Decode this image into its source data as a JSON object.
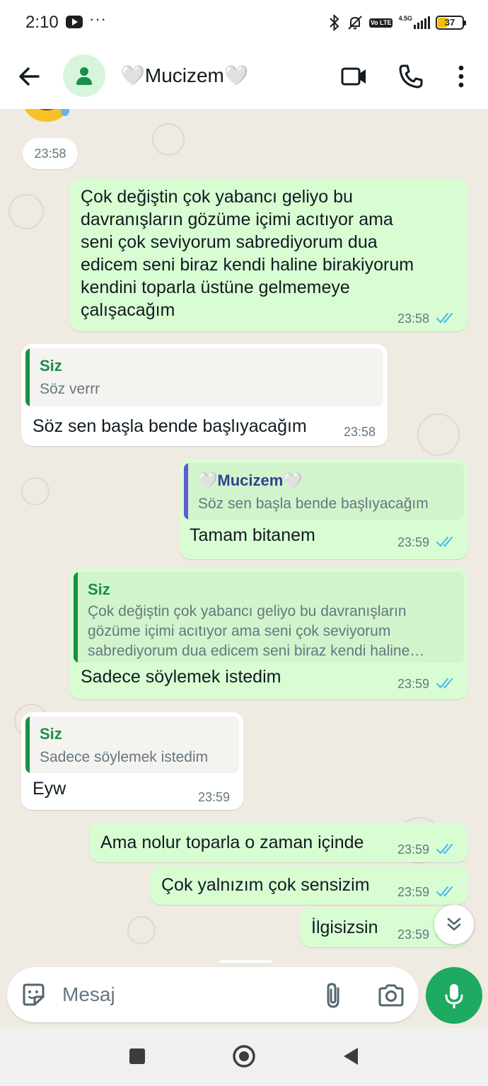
{
  "status_bar": {
    "time": "2:10",
    "dots": "···",
    "network": "4.5G",
    "lte_badge": "Vo LTE",
    "battery_level": "37",
    "icons": [
      "youtube-icon",
      "bluetooth-icon",
      "bell-off-icon",
      "signal-icon",
      "battery-icon"
    ]
  },
  "header": {
    "contact_name": "🤍Mucizem🤍",
    "icons": [
      "back-arrow-icon",
      "avatar-icon",
      "video-call-icon",
      "phone-call-icon",
      "more-vert-icon"
    ]
  },
  "chat": {
    "date_chip_time": "23:58",
    "messages": [
      {
        "direction": "out",
        "text": "Çok değiştin çok yabancı geliyo bu\ndavranışların gözüme içimi acıtıyor ama\nseni çok seviyorum sabrediyorum dua\nedicem seni biraz kendi haline birakiyorum\nkendini toparla üstüne gelmemeye\nçalışacağım",
        "time": "23:58",
        "read": true
      },
      {
        "direction": "in",
        "quote": {
          "author": "Siz",
          "text": "Söz verrr"
        },
        "text": "Söz sen başla bende başlıyacağım",
        "time": "23:58"
      },
      {
        "direction": "out",
        "quote": {
          "author": "🤍Mucizem🤍",
          "text": "Söz sen başla bende başlıyacağım"
        },
        "text": "Tamam bitanem",
        "time": "23:59",
        "read": true
      },
      {
        "direction": "out",
        "quote": {
          "author": "Siz",
          "text": "Çok değiştin çok yabancı geliyo bu davranışların gözüme içimi acıtıyor ama seni çok seviyorum sabrediyorum dua edicem seni biraz kendi haline birakiyorum kendini toparla üstüne gelmemeye çalışacağım"
        },
        "text": "Sadece söylemek istedim",
        "time": "23:59",
        "read": true
      },
      {
        "direction": "in",
        "quote": {
          "author": "Siz",
          "text": "Sadece söylemek istedim"
        },
        "text": "Eyw",
        "time": "23:59"
      },
      {
        "direction": "out",
        "text": "Ama nolur toparla o zaman içinde",
        "time": "23:59",
        "read": true
      },
      {
        "direction": "out",
        "text": "Çok yalnızım çok sensizim",
        "time": "23:59",
        "read": true
      },
      {
        "direction": "out",
        "text": "İlgisizsin",
        "time": "23:59",
        "read": true
      }
    ],
    "scroll_button_icon": "chevron-double-down-icon"
  },
  "composer": {
    "placeholder": "Mesaj",
    "value": "",
    "icons": [
      "sticker-icon",
      "paperclip-icon",
      "camera-icon",
      "microphone-icon"
    ]
  },
  "navbar": {
    "icons": [
      "recents-square-icon",
      "home-circle-icon",
      "back-triangle-icon"
    ]
  },
  "colors": {
    "chat_background": "#efeae2",
    "outgoing_bubble": "#d9fdd3",
    "incoming_bubble": "#ffffff",
    "read_ticks": "#53bdeb",
    "accent_green": "#1daa61",
    "quote_self": "#1a8f47",
    "quote_contact": "#5e5ad8"
  }
}
